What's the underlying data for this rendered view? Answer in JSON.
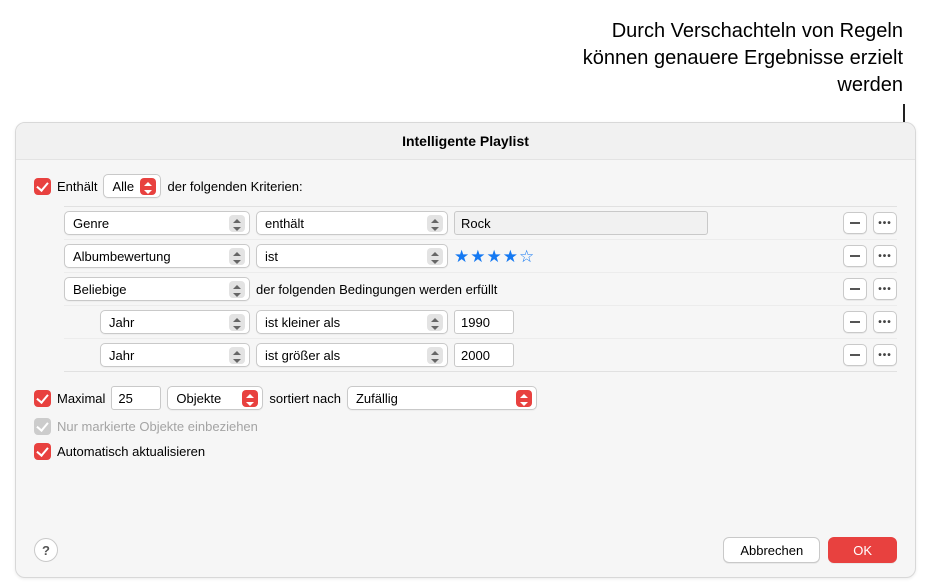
{
  "annotation": "Durch Verschachteln von Regeln können genauere Ergebnisse erzielt werden",
  "panel": {
    "title": "Intelligente Playlist"
  },
  "match": {
    "enabled": true,
    "prefix": "Enthält",
    "mode": "Alle",
    "suffix": "der folgenden Kriterien:"
  },
  "rules": [
    {
      "field": "Genre",
      "op": "enthält",
      "value": "Rock",
      "type": "text"
    },
    {
      "field": "Albumbewertung",
      "op": "ist",
      "stars": 4,
      "type": "stars"
    },
    {
      "field": "Beliebige",
      "suffix": "der folgenden Bedingungen werden erfüllt",
      "type": "group"
    },
    {
      "field": "Jahr",
      "op": "ist kleiner als",
      "value": "1990",
      "type": "num",
      "indent": 1
    },
    {
      "field": "Jahr",
      "op": "ist größer als",
      "value": "2000",
      "type": "num",
      "indent": 1
    }
  ],
  "limit": {
    "enabled": true,
    "label": "Maximal",
    "count": "25",
    "unit": "Objekte",
    "sort_prefix": "sortiert nach",
    "sort": "Zufällig"
  },
  "only_checked": {
    "enabled": false,
    "checked": true,
    "label": "Nur markierte Objekte einbeziehen"
  },
  "live_update": {
    "enabled": true,
    "label": "Automatisch aktualisieren"
  },
  "footer": {
    "help": "?",
    "cancel": "Abbrechen",
    "ok": "OK"
  }
}
